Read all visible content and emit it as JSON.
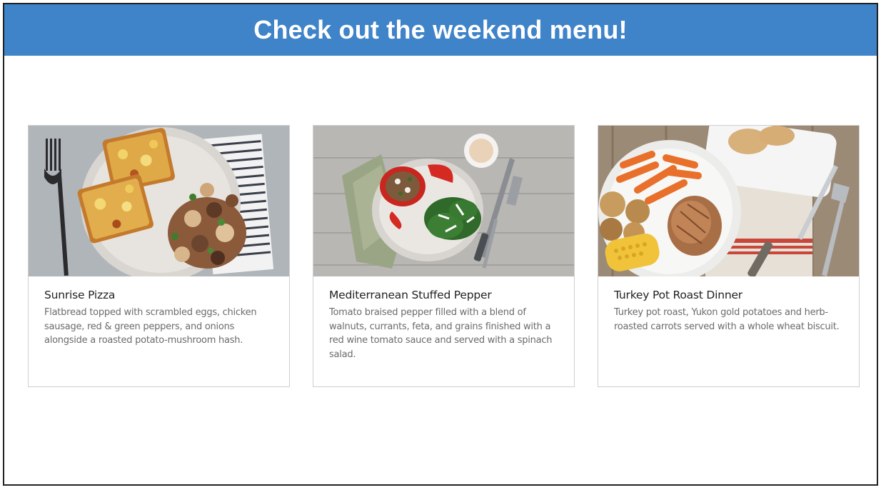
{
  "banner": {
    "title": "Check out the weekend menu!"
  },
  "menu": {
    "items": [
      {
        "title": "Sunrise Pizza",
        "description": "Flatbread topped with scrambled eggs, chicken sausage, red & green peppers, and onions alongside a roasted potato-mushroom hash."
      },
      {
        "title": "Mediterranean Stuffed Pepper",
        "description": "Tomato braised pepper filled with a blend of walnuts, currants, feta, and grains finished with a red wine tomato sauce and served with a spinach salad."
      },
      {
        "title": "Turkey Pot Roast Dinner",
        "description": "Turkey pot roast, Yukon gold potatoes and herb-roasted carrots served with a whole wheat biscuit."
      }
    ]
  },
  "colors": {
    "banner": "#3f83c8",
    "banner_text": "#ffffff",
    "card_border": "#cfcfcf"
  }
}
